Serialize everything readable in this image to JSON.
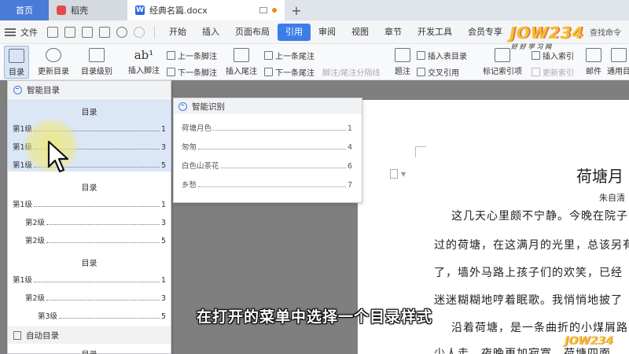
{
  "tabs": {
    "home": "首页",
    "wps": "稻壳",
    "doc": "经典名篇.docx",
    "new_tab": "+"
  },
  "menubar": {
    "file_menu": "文件",
    "tabs": [
      "开始",
      "插入",
      "页面布局",
      "引用",
      "审阅",
      "视图",
      "章节",
      "开发工具",
      "会员专享"
    ],
    "active_tab": "引用",
    "search": "查找命令"
  },
  "ribbon": {
    "toc": "目录",
    "update_toc": "更新目录",
    "toc_level": "目录级别",
    "insert_footnote": "插入脚注",
    "prev_footnote": "上一条脚注",
    "next_footnote": "下一条脚注",
    "insert_endnote": "插入尾注",
    "prev_endnote": "上一条尾注",
    "next_endnote": "下一条尾注",
    "separator": "脚注/尾注分隔线",
    "caption": "题注",
    "insert_table_of_figures": "插入表目录",
    "cross_reference": "交叉引用",
    "mark_index": "标记索引项",
    "insert_index": "插入索引",
    "update_index": "更新索引",
    "mail": "邮件",
    "general_dir": "通用目"
  },
  "toc_menu": {
    "smart_toc_label": "智能目录",
    "template_title": "目录",
    "templates": [
      {
        "title": "目录",
        "rows": [
          {
            "label": "第1级",
            "page": "1"
          },
          {
            "label": "第1级",
            "page": "3"
          },
          {
            "label": "第1级",
            "page": "5"
          }
        ]
      },
      {
        "title": "目录",
        "rows": [
          {
            "label": "第1级",
            "page": "1"
          },
          {
            "label": "第2级",
            "page": "3"
          },
          {
            "label": "第2级",
            "page": "5"
          }
        ]
      },
      {
        "title": "目录",
        "rows": [
          {
            "label": "第1级",
            "page": "1"
          },
          {
            "label": "第2级",
            "page": "3"
          },
          {
            "label": "第3级",
            "page": "5"
          }
        ]
      }
    ],
    "auto_toc_label": "自动目录",
    "auto_template_title": "目录"
  },
  "smart_identify": {
    "label": "智能识别",
    "rows": [
      {
        "label": "荷塘月色",
        "page": "1"
      },
      {
        "label": "匆匆",
        "page": "4"
      },
      {
        "label": "白色山茶花",
        "page": "6"
      },
      {
        "label": "乡愁",
        "page": "7"
      }
    ]
  },
  "document": {
    "title": "荷塘月",
    "author": "朱自清",
    "lines": [
      "这几天心里颇不宁静。今晚在院子",
      "过的荷塘，在这满月的光里，总该另有",
      "了，墙外马路上孩子们的欢笑，已经",
      "迷迷糊糊地哼着眠歌。我悄悄地披了",
      "沿着荷塘，是一条曲折的小煤屑路",
      "少人走，夜晚更加寂寞。荷塘四面，"
    ]
  },
  "subtitle": "在打开的菜单中选择一个目录样式",
  "watermark": {
    "brand": "JOW234",
    "sub": "好 好 学 习 网"
  },
  "colors": {
    "accent": "#3b7de9",
    "home_tab": "#4a7bd6",
    "hover_row": "#dbe6f7",
    "highlight": "#f0e878"
  }
}
